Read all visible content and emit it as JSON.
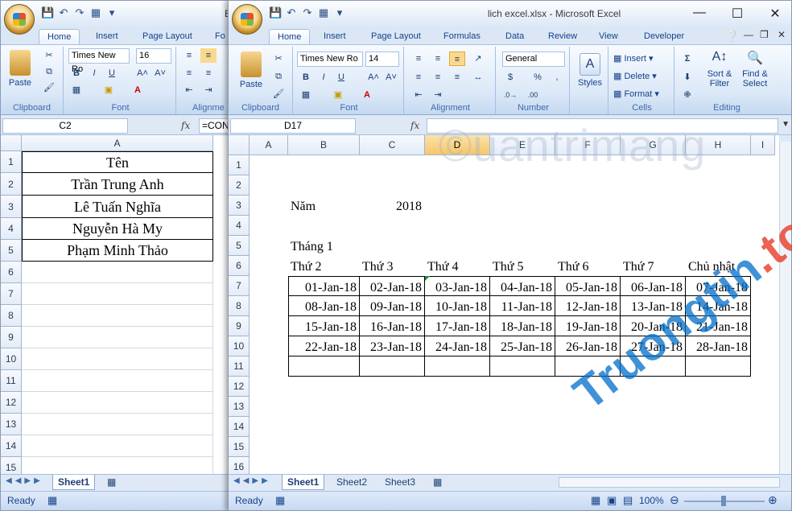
{
  "win1": {
    "title_partial": "E",
    "tabs": [
      "Home",
      "Insert",
      "Page Layout",
      "Fo"
    ],
    "font": {
      "name": "Times New Ro",
      "size": "16"
    },
    "groups": [
      "Clipboard",
      "Font",
      "Alignme"
    ],
    "paste_label": "Paste",
    "namebox": "C2",
    "formula": "=CON",
    "col_header": "A",
    "rows": [
      "1",
      "2",
      "3",
      "4",
      "5",
      "6",
      "7",
      "8",
      "9",
      "10",
      "11",
      "12",
      "13",
      "14",
      "15"
    ],
    "cells": [
      "Tên",
      "Trần Trung Anh",
      "Lê Tuấn Nghĩa",
      "Nguyễn Hà My",
      "Phạm Minh Thảo"
    ],
    "sheet_tab": "Sheet1",
    "status": "Ready"
  },
  "win2": {
    "title": "lich excel.xlsx - Microsoft Excel",
    "tabs": [
      "Home",
      "Insert",
      "Page Layout",
      "Formulas",
      "Data",
      "Review",
      "View",
      "Developer"
    ],
    "font": {
      "name": "Times New Ro",
      "size": "14"
    },
    "number_format": "General",
    "paste_label": "Paste",
    "styles_label": "Styles",
    "cells_buttons": [
      "Insert",
      "Delete",
      "Format"
    ],
    "editing_buttons": [
      "Sort &",
      "Filter",
      "Find &",
      "Select"
    ],
    "groups": [
      "Clipboard",
      "Font",
      "Alignment",
      "Number",
      "Cells",
      "Editing"
    ],
    "namebox": "D17",
    "formula": "",
    "col_headers": [
      "A",
      "B",
      "C",
      "D",
      "E",
      "F",
      "G",
      "H",
      "I"
    ],
    "rows": [
      "1",
      "2",
      "3",
      "4",
      "5",
      "6",
      "7",
      "8",
      "9",
      "10",
      "11",
      "12",
      "13",
      "14",
      "15",
      "16"
    ],
    "year_label": "Năm",
    "year_value": "2018",
    "month_label": "Tháng 1",
    "weekdays": [
      "Thứ 2",
      "Thứ 3",
      "Thứ 4",
      "Thứ 5",
      "Thứ 6",
      "Thứ 7",
      "Chủ nhật"
    ],
    "calendar": [
      [
        "01-Jan-18",
        "02-Jan-18",
        "03-Jan-18",
        "04-Jan-18",
        "05-Jan-18",
        "06-Jan-18",
        "07-Jan-18"
      ],
      [
        "08-Jan-18",
        "09-Jan-18",
        "10-Jan-18",
        "11-Jan-18",
        "12-Jan-18",
        "13-Jan-18",
        "14-Jan-18"
      ],
      [
        "15-Jan-18",
        "16-Jan-18",
        "17-Jan-18",
        "18-Jan-18",
        "19-Jan-18",
        "20-Jan-18",
        "21-Jan-18"
      ],
      [
        "22-Jan-18",
        "23-Jan-18",
        "24-Jan-18",
        "25-Jan-18",
        "26-Jan-18",
        "27-Jan-18",
        "28-Jan-18"
      ]
    ],
    "sheet_tabs": [
      "Sheet1",
      "Sheet2",
      "Sheet3"
    ],
    "status": "Ready",
    "zoom": "100%"
  },
  "watermarks": {
    "top": "uantrimang",
    "bottom_main": "Truongtin",
    "bottom_suffix": ".top"
  },
  "colors": {
    "ribbon": "#dbe8f7",
    "selected_header": "#f7c66a",
    "accent": "#15428b"
  }
}
